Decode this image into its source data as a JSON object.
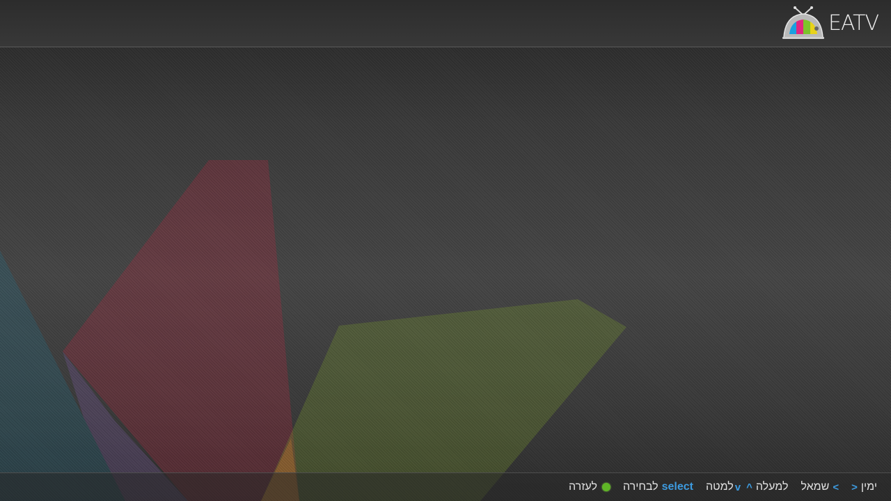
{
  "header": {
    "brand": "EATV",
    "logo_icon": "tv-logo-icon"
  },
  "footer": {
    "hints": [
      {
        "key": "<",
        "label": "ימין"
      },
      {
        "key": ">",
        "label": "שמאל"
      },
      {
        "key": "^",
        "label": "למעלה"
      },
      {
        "key": "v",
        "label": "למטה"
      },
      {
        "key": "select",
        "label": "לבחירה"
      },
      {
        "key": "green-button",
        "label": "לעזרה"
      }
    ]
  },
  "colors": {
    "accent_blue": "#3d9be0",
    "help_green": "#5fb526",
    "beam_blue": "#1f6f8a",
    "beam_red": "#b0283f",
    "beam_green": "#7fa02a",
    "beam_purple": "#7a5aa0",
    "beam_orange": "#c8782a"
  }
}
